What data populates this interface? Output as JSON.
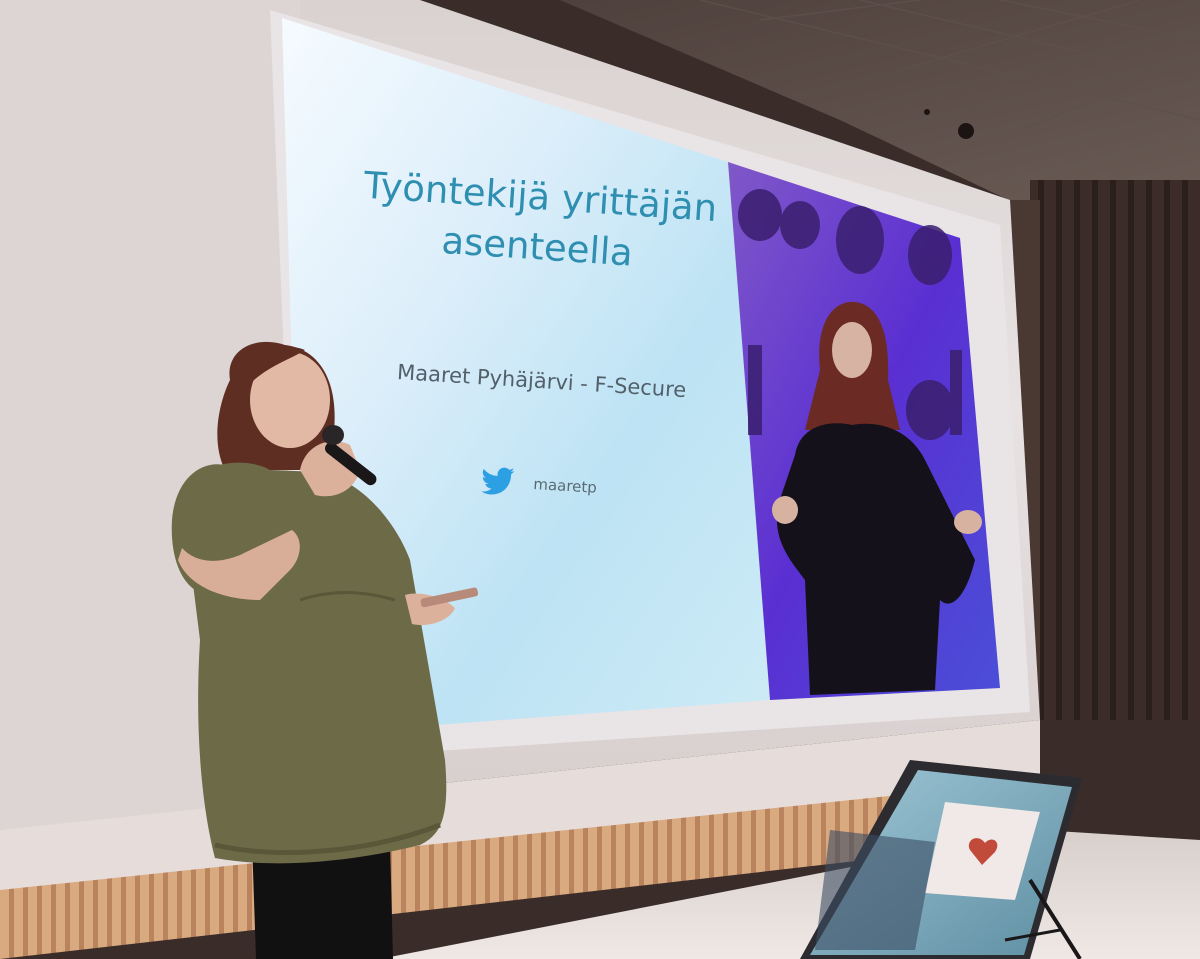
{
  "slide": {
    "title_line_1": "Työntekijä yrittäjän",
    "title_line_2": "asenteella",
    "speaker_line": "Maaret Pyhäjärvi - F-Secure",
    "twitter_handle": "maaretp",
    "icon": "twitter-bird-icon",
    "accent_color": "#2e8fb1"
  },
  "colors": {
    "twitter_blue": "#2d9fe3",
    "photo_purple": "#5b2fd0",
    "dress_olive": "#6d6a48"
  }
}
